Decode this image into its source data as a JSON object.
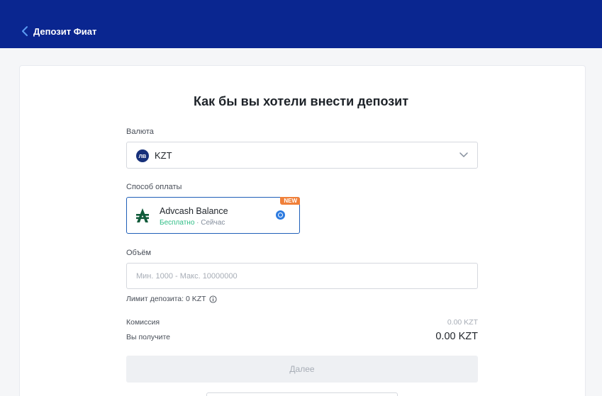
{
  "header": {
    "title": "Депозит Фиат"
  },
  "main": {
    "heading": "Как бы вы хотели внести депозит",
    "currency": {
      "label": "Валюта",
      "icon_text": "ЛВ",
      "value": "KZT"
    },
    "payment": {
      "label": "Способ оплаты",
      "method_name": "Advcash Balance",
      "fee": "Бесплатно",
      "time": " · Сейчас",
      "badge": "NEW"
    },
    "amount": {
      "label": "Объём",
      "placeholder": "Мин. 1000 - Макс. 10000000",
      "value": ""
    },
    "limit": "Лимит депозита: 0 KZT",
    "commission": {
      "label": "Комиссия",
      "value": "0.00 KZT"
    },
    "receive": {
      "label": "Вы получите",
      "value": "0.00 KZT"
    },
    "submit_label": "Далее"
  },
  "colors": {
    "header_bg": "#0a2690",
    "accent": "#2d7be0",
    "badge": "#f0803a",
    "free": "#2ebd85"
  }
}
